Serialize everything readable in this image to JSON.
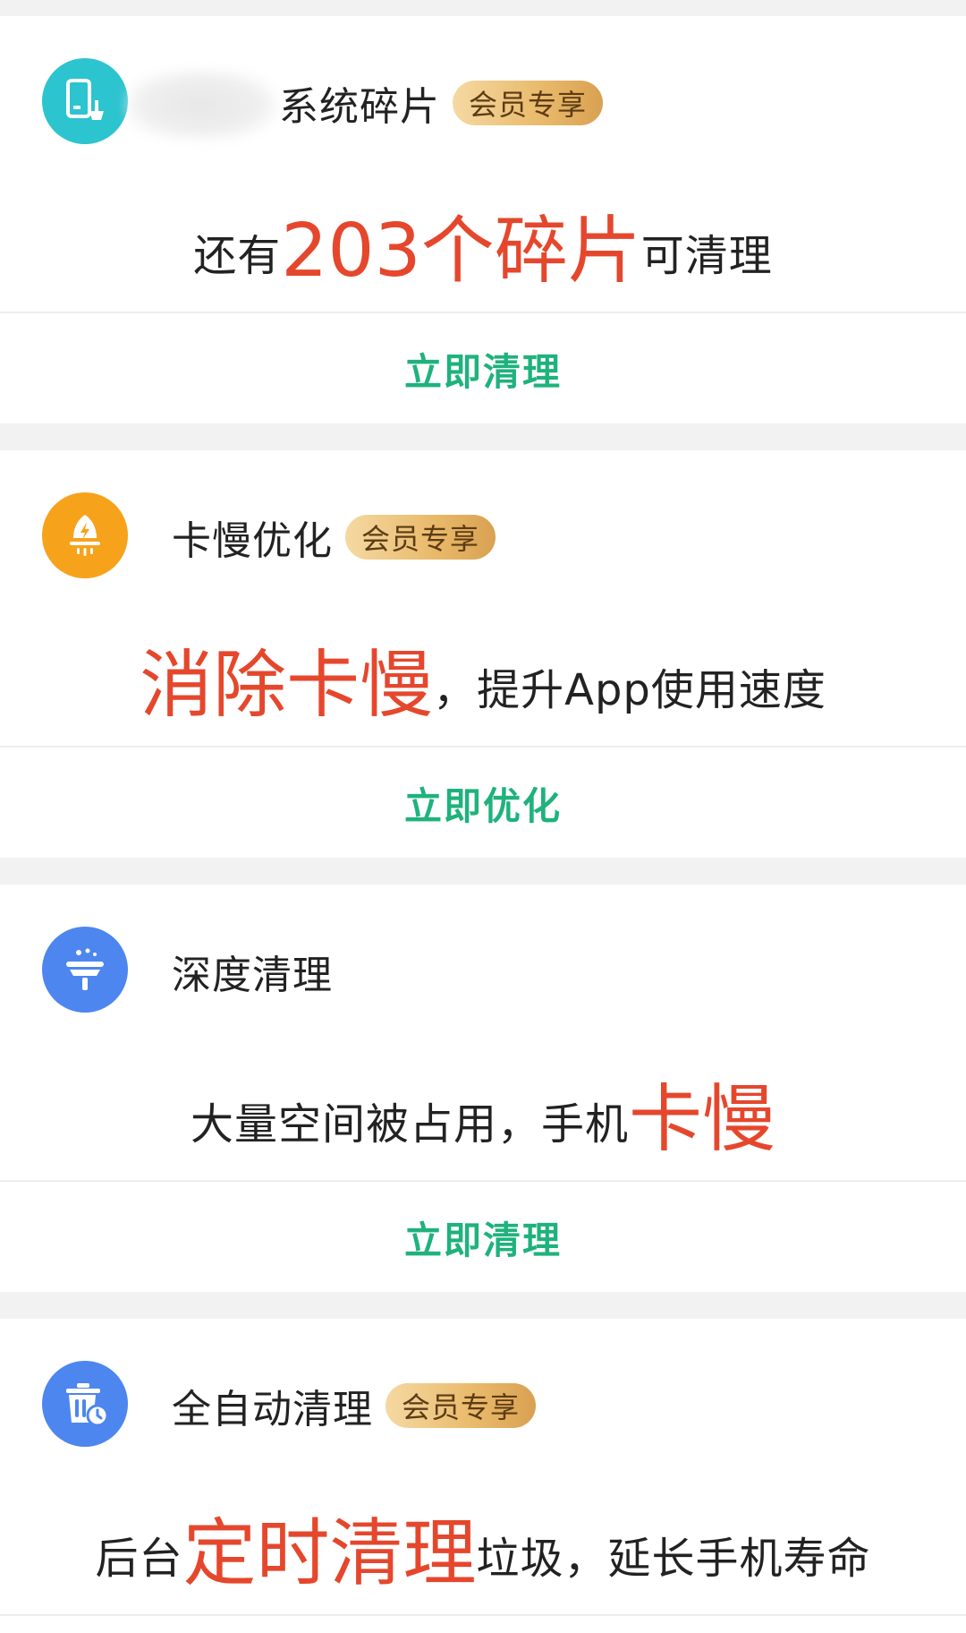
{
  "cards": [
    {
      "icon": "phone-broom-icon",
      "icon_color": "#2cc4cf",
      "title": "系统碎片",
      "badge": "会员专享",
      "headline": {
        "pre": "还有",
        "highlight": "203个碎片",
        "post": "可清理"
      },
      "action": "立即清理"
    },
    {
      "icon": "rocket-icon",
      "icon_color": "#f7a21b",
      "title": "卡慢优化",
      "badge": "会员专享",
      "headline": {
        "pre": "",
        "highlight": "消除卡慢",
        "post": "，提升App使用速度"
      },
      "action": "立即优化"
    },
    {
      "icon": "broom-sparkle-icon",
      "icon_color": "#4d86ef",
      "title": "深度清理",
      "badge": "",
      "headline": {
        "pre": "大量空间被占用，手机",
        "highlight": "卡慢",
        "post": ""
      },
      "action": "立即清理"
    },
    {
      "icon": "trash-clock-icon",
      "icon_color": "#4d86ef",
      "title": "全自动清理",
      "badge": "会员专享",
      "headline": {
        "pre": "后台",
        "highlight": "定时清理",
        "post": "垃圾，延长手机寿命"
      },
      "action": ""
    }
  ],
  "colors": {
    "accent_green": "#1fb27c",
    "highlight_red": "#e5472d",
    "badge_gold": "#e9b96a",
    "background": "#f2f2f2"
  }
}
